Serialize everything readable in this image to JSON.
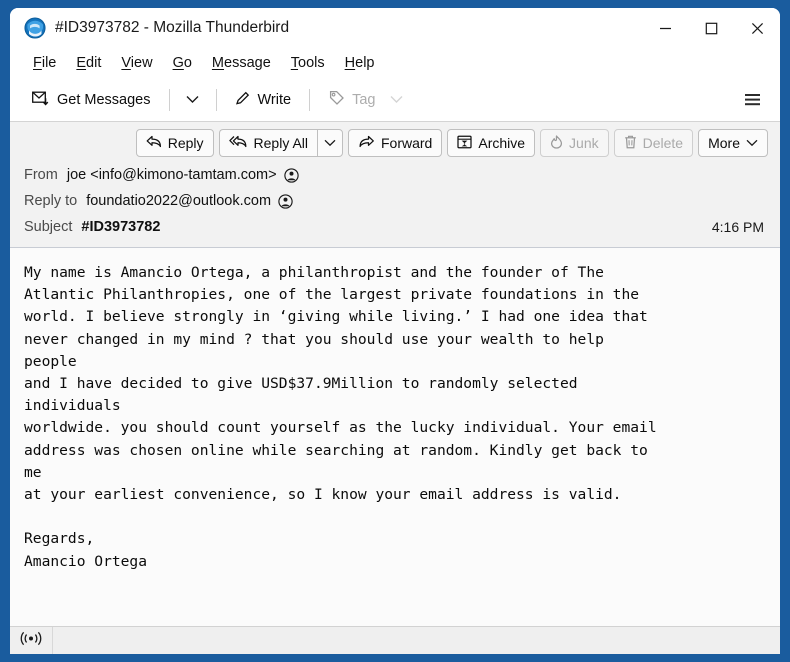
{
  "window": {
    "title": "#ID3973782 - Mozilla Thunderbird",
    "logo_icon": "thunderbird-logo-icon",
    "controls": {
      "minimize": "minimize-icon",
      "maximize": "maximize-icon",
      "close": "close-icon"
    }
  },
  "menu_bar": {
    "items": [
      {
        "label": "File",
        "accesskey": "F"
      },
      {
        "label": "Edit",
        "accesskey": "E"
      },
      {
        "label": "View",
        "accesskey": "V"
      },
      {
        "label": "Go",
        "accesskey": "G"
      },
      {
        "label": "Message",
        "accesskey": "M"
      },
      {
        "label": "Tools",
        "accesskey": "T"
      },
      {
        "label": "Help",
        "accesskey": "H"
      }
    ]
  },
  "main_toolbar": {
    "get_messages": {
      "label": "Get Messages",
      "icon": "envelope-download-icon",
      "enabled": true
    },
    "get_messages_chevron": "chevron-down-icon",
    "write": {
      "label": "Write",
      "icon": "pencil-icon",
      "enabled": true
    },
    "tag": {
      "label": "Tag",
      "icon": "tag-icon",
      "enabled": false
    },
    "tag_chevron": "chevron-down-icon",
    "hamburger": "hamburger-menu-icon"
  },
  "message_toolbar": {
    "reply": {
      "label": "Reply",
      "icon": "reply-arrow-icon",
      "enabled": true
    },
    "reply_all": {
      "label": "Reply All",
      "icon": "reply-all-arrow-icon",
      "enabled": true
    },
    "reply_all_chevron": "chevron-down-icon",
    "forward": {
      "label": "Forward",
      "icon": "forward-arrow-icon",
      "enabled": true
    },
    "archive": {
      "label": "Archive",
      "icon": "archive-box-icon",
      "enabled": true
    },
    "junk": {
      "label": "Junk",
      "icon": "flame-icon",
      "enabled": false
    },
    "delete": {
      "label": "Delete",
      "icon": "trash-icon",
      "enabled": false
    },
    "more": {
      "label": "More",
      "icon": "chevron-down-icon",
      "enabled": true
    }
  },
  "message_header": {
    "from_label": "From",
    "from_value": "joe <info@kimono-tamtam.com>",
    "reply_to_label": "Reply to",
    "reply_to_value": "foundatio2022@outlook.com",
    "subject_label": "Subject",
    "subject_value": "#ID3973782",
    "date": "4:16 PM",
    "contact_icon": "contact-person-icon"
  },
  "message_body": {
    "text": "My name is Amancio Ortega, a philanthropist and the founder of The\nAtlantic Philanthropies, one of the largest private foundations in the\nworld. I believe strongly in ‘giving while living.’ I had one idea that\nnever changed in my mind ? that you should use your wealth to help\npeople\nand I have decided to give USD$37.9Million to randomly selected\nindividuals\nworldwide. you should count yourself as the lucky individual. Your email\naddress was chosen online while searching at random. Kindly get back to\nme\nat your earliest convenience, so I know your email address is valid.\n\nRegards,\nAmancio Ortega"
  },
  "status_bar": {
    "icon": "broadcast-signal-icon"
  },
  "colors": {
    "window_border": "#1a5c9e",
    "toolbar_bg": "#ffffff",
    "header_bg": "#f2f2f2",
    "body_bg": "#fbfbfb",
    "status_bg": "#efefef",
    "text": "#101010",
    "disabled_text": "#adadad"
  }
}
